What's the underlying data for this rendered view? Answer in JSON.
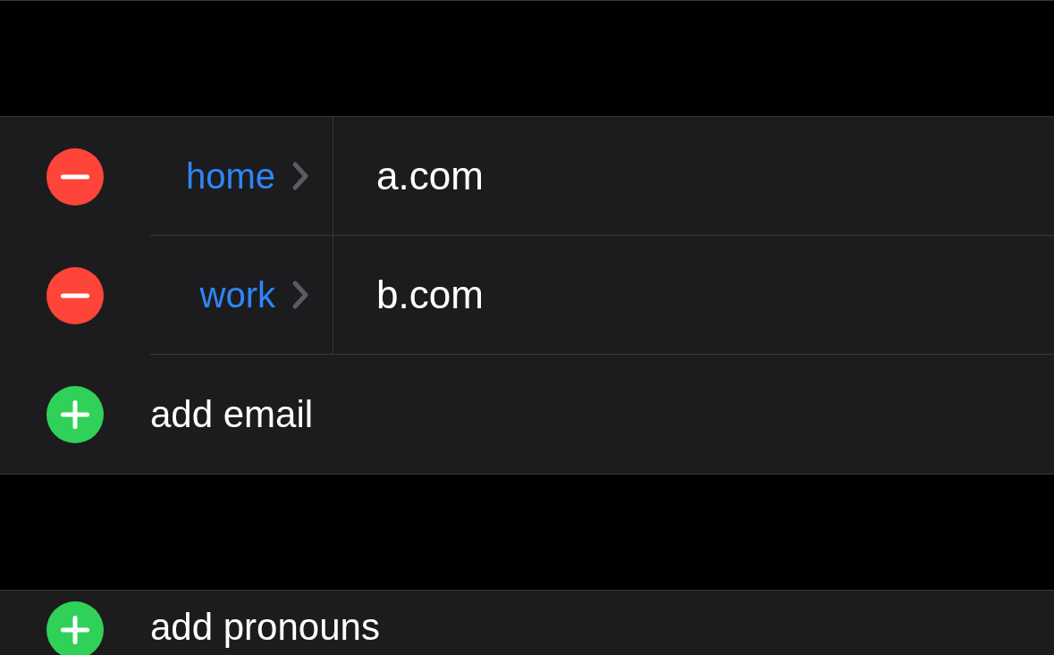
{
  "sections": [
    {
      "rows": [
        {
          "kind": "remove",
          "label": "home",
          "value": "a.com"
        },
        {
          "kind": "remove",
          "label": "work",
          "value": "b.com"
        },
        {
          "kind": "add",
          "text": "add email"
        }
      ]
    },
    {
      "rows": [
        {
          "kind": "add",
          "text": "add pronouns"
        }
      ]
    }
  ]
}
